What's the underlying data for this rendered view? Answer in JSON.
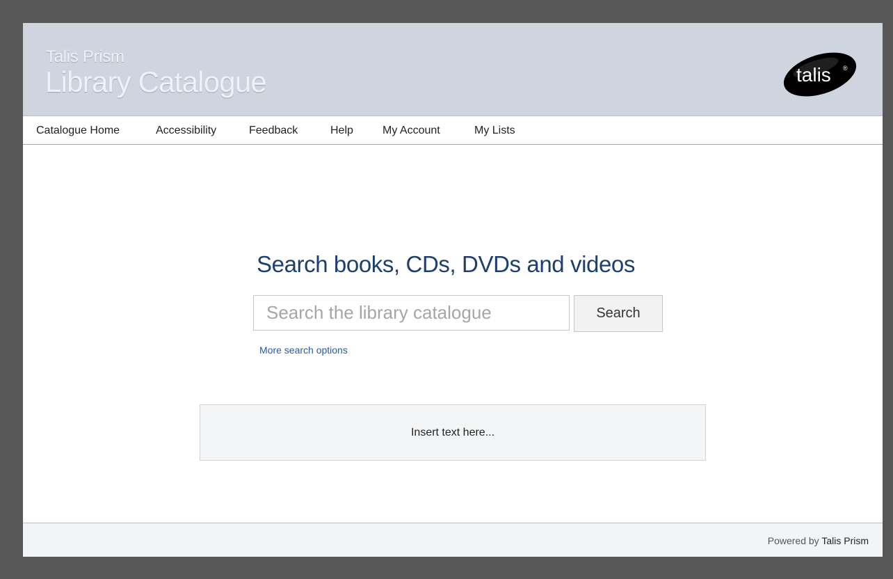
{
  "header": {
    "subtitle": "Talis Prism",
    "title": "Library Catalogue",
    "logo_text": "talis",
    "logo_mark": "®"
  },
  "nav": {
    "items": [
      {
        "label": "Catalogue Home"
      },
      {
        "label": "Accessibility"
      },
      {
        "label": "Feedback"
      },
      {
        "label": "Help"
      },
      {
        "label": "My Account"
      },
      {
        "label": "My Lists"
      }
    ]
  },
  "search": {
    "heading": "Search books, CDs, DVDs and videos",
    "placeholder": "Search the library catalogue",
    "value": "",
    "button_label": "Search",
    "more_options_label": "More search options"
  },
  "info_box": {
    "text": "Insert text here..."
  },
  "footer": {
    "powered_prefix": "Powered by ",
    "powered_brand": "Talis Prism"
  },
  "colors": {
    "page_border": "#575757",
    "banner_bg": "#cfd5df",
    "heading": "#1d3f6e",
    "link": "#2b5aa0"
  }
}
